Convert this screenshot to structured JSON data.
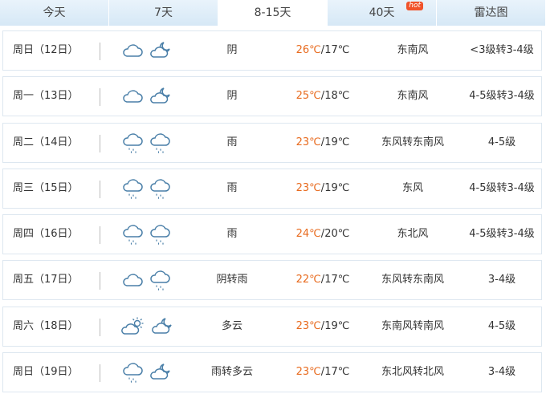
{
  "tabs": [
    {
      "label": "今天",
      "width": 136
    },
    {
      "label": "7天",
      "width": 136
    },
    {
      "label": "8-15天",
      "width": 136,
      "active": true
    },
    {
      "label": "40天",
      "width": 136,
      "badge": "hot"
    },
    {
      "label": "雷达图",
      "width": 136
    }
  ],
  "accent_color": "#e86b1f",
  "days": [
    {
      "date": "周日（12日）",
      "icons": [
        "cloud-icon",
        "partly-cloudy-night-icon"
      ],
      "desc": "阴",
      "high": "26℃",
      "low": "17℃",
      "wind": "东南风",
      "level": "<3级转3-4级"
    },
    {
      "date": "周一（13日）",
      "icons": [
        "cloud-icon",
        "partly-cloudy-night-icon"
      ],
      "desc": "阴",
      "high": "25℃",
      "low": "18℃",
      "wind": "东南风",
      "level": "4-5级转3-4级"
    },
    {
      "date": "周二（14日）",
      "icons": [
        "rain-icon",
        "rain-icon"
      ],
      "desc": "雨",
      "high": "23℃",
      "low": "19℃",
      "wind": "东风转东南风",
      "level": "4-5级"
    },
    {
      "date": "周三（15日）",
      "icons": [
        "rain-icon",
        "rain-icon"
      ],
      "desc": "雨",
      "high": "23℃",
      "low": "19℃",
      "wind": "东风",
      "level": "4-5级转3-4级"
    },
    {
      "date": "周四（16日）",
      "icons": [
        "rain-icon",
        "rain-icon"
      ],
      "desc": "雨",
      "high": "24℃",
      "low": "20℃",
      "wind": "东北风",
      "level": "4-5级转3-4级"
    },
    {
      "date": "周五（17日）",
      "icons": [
        "cloud-icon",
        "rain-icon"
      ],
      "desc": "阴转雨",
      "high": "22℃",
      "low": "17℃",
      "wind": "东风转东南风",
      "level": "3-4级"
    },
    {
      "date": "周六（18日）",
      "icons": [
        "partly-cloudy-day-icon",
        "partly-cloudy-night-icon"
      ],
      "desc": "多云",
      "high": "23℃",
      "low": "19℃",
      "wind": "东南风转南风",
      "level": "4-5级"
    },
    {
      "date": "周日（19日）",
      "icons": [
        "rain-icon",
        "partly-cloudy-night-icon"
      ],
      "desc": "雨转多云",
      "high": "23℃",
      "low": "17℃",
      "wind": "东北风转北风",
      "level": "3-4级"
    }
  ]
}
